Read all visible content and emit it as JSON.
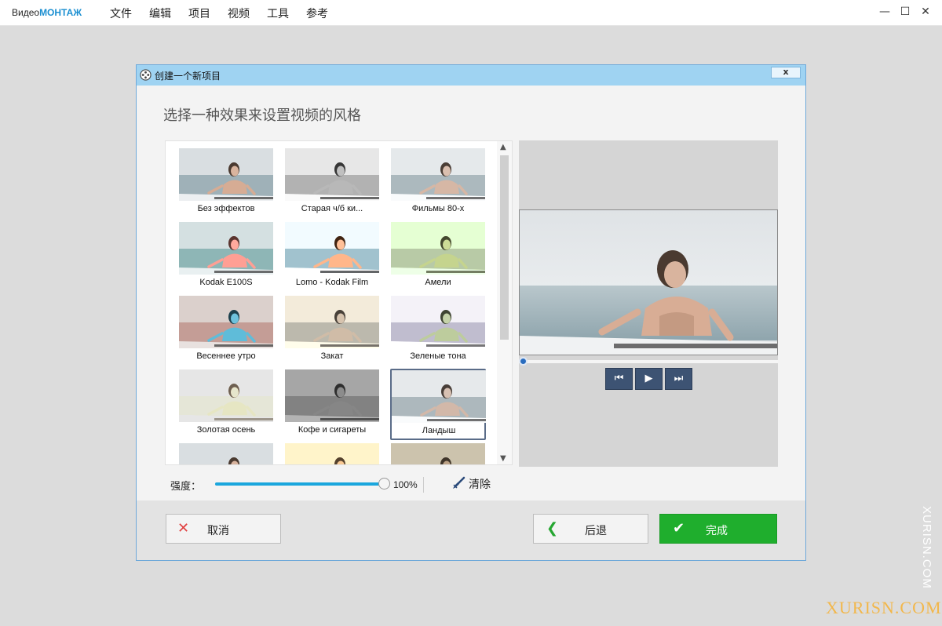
{
  "app": {
    "logo_prefix": "Видео",
    "logo_accent": "МОНТАЖ",
    "menu": [
      "文件",
      "编辑",
      "项目",
      "视频",
      "工具",
      "参考"
    ],
    "window_controls": {
      "minimize": "—",
      "maximize": "☐",
      "close": "✕"
    }
  },
  "dialog": {
    "title": "创建一个新项目",
    "close_label": "x",
    "heading": "选择一种效果来设置视频的风格"
  },
  "effects": [
    {
      "label": "Без эффектов",
      "filter": "none",
      "selected": false
    },
    {
      "label": "Старая ч/б ки...",
      "filter": "bw",
      "selected": false
    },
    {
      "label": "Фильмы 80-х",
      "filter": "80s",
      "selected": false
    },
    {
      "label": "Kodak E100S",
      "filter": "kodak",
      "selected": false
    },
    {
      "label": "Lomo - Kodak Film",
      "filter": "lomo",
      "selected": false
    },
    {
      "label": "Амели",
      "filter": "ameli",
      "selected": false
    },
    {
      "label": "Весеннее утро",
      "filter": "spring",
      "selected": false
    },
    {
      "label": "Закат",
      "filter": "sunset",
      "selected": false
    },
    {
      "label": "Зеленые тона",
      "filter": "green",
      "selected": false
    },
    {
      "label": "Золотая осень",
      "filter": "gold",
      "selected": false
    },
    {
      "label": "Кофе и сигареты",
      "filter": "coffee",
      "selected": false
    },
    {
      "label": "Ландыш",
      "filter": "lily",
      "selected": true
    },
    {
      "label": "",
      "filter": "none",
      "selected": false
    },
    {
      "label": "",
      "filter": "yellow",
      "selected": false
    },
    {
      "label": "",
      "filter": "dark",
      "selected": false
    }
  ],
  "strength": {
    "label": "强度：",
    "value": 100,
    "value_text": "100%",
    "clear_label": "清除"
  },
  "preview": {
    "progress": 0,
    "controls": {
      "prev": "⏮",
      "play": "▶",
      "next": "⏭"
    }
  },
  "footer": {
    "cancel_label": "取消",
    "back_label": "后退",
    "finish_label": "完成"
  },
  "colors": {
    "accent": "#1b8fd1",
    "finish": "#1fae2d",
    "slider": "#1aa6dd",
    "player_button": "#3d5373"
  },
  "watermark": {
    "vertical": "XURISN.COM",
    "horizontal": "XURISN.COM"
  }
}
